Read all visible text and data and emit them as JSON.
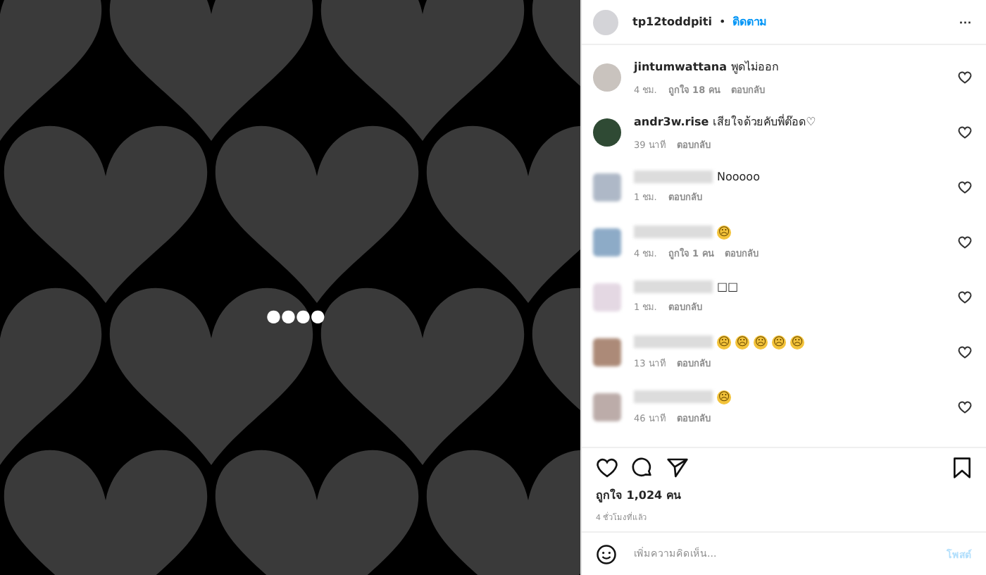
{
  "post": {
    "overlay_dots": "●●●●"
  },
  "header": {
    "username": "tp12toddpiti",
    "separator": "•",
    "follow": "ติดตาม",
    "more": "···"
  },
  "comments": [
    {
      "kind": "named",
      "username": "jintumwattana",
      "text": "พูดไม่ออก",
      "time": "4 ชม.",
      "likes": "ถูกใจ 18 คน",
      "reply": "ตอบกลับ"
    },
    {
      "kind": "named",
      "username": "andr3w.rise",
      "text": "เสียใจด้วยคับพี่ต๊อด♡",
      "time": "39 นาที",
      "reply": "ตอบกลับ"
    },
    {
      "kind": "blurred",
      "text": "Nooooo",
      "time": "1 ชม.",
      "reply": "ตอบกลับ"
    },
    {
      "kind": "blurred",
      "emojis": [
        "☹"
      ],
      "time": "4 ชม.",
      "likes": "ถูกใจ 1 คน",
      "reply": "ตอบกลับ"
    },
    {
      "kind": "blurred",
      "text": "□□",
      "time": "1 ชม.",
      "reply": "ตอบกลับ"
    },
    {
      "kind": "blurred",
      "emojis": [
        "☹",
        "☹",
        "☹",
        "☹",
        "☹"
      ],
      "time": "13 นาที",
      "reply": "ตอบกลับ"
    },
    {
      "kind": "blurred",
      "emojis": [
        "☹"
      ],
      "time": "46 นาที",
      "reply": "ตอบกลับ"
    }
  ],
  "likes": "ถูกใจ 1,024 คน",
  "date": "4 ชั่วโมงที่แล้ว",
  "add_comment": {
    "placeholder": "เพิ่มความคิดเห็น...",
    "post": "โพสต์"
  }
}
